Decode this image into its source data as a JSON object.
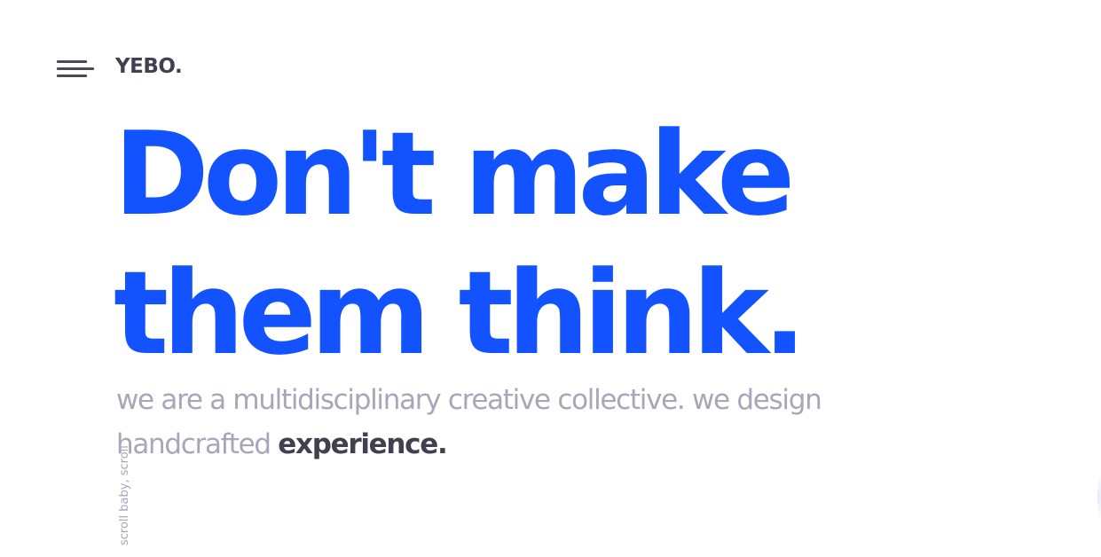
{
  "header": {
    "menu_icon": "hamburger-menu-icon",
    "logo": "YEBO."
  },
  "hero": {
    "headline_line1": "Don't make",
    "headline_line2": "them think.",
    "tagline_regular": "we are a multidisciplinary creative collective. we design handcrafted ",
    "tagline_strong": "experience."
  },
  "scroll_hint": "scroll baby, scroll",
  "colors": {
    "accent": "#1252ff",
    "text_dark": "#3f4050",
    "text_muted": "#a6a7b8",
    "background": "#ffffff"
  }
}
